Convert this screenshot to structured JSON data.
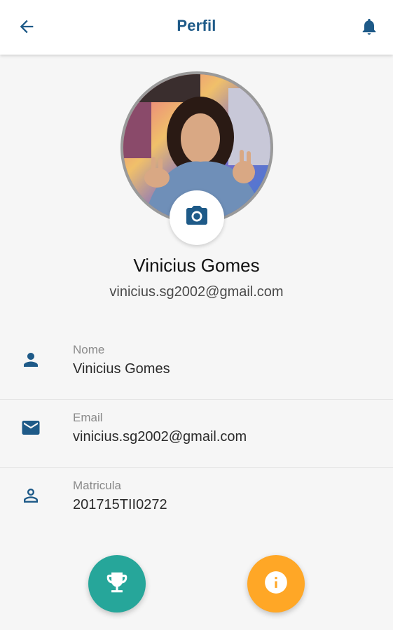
{
  "header": {
    "title": "Perfil",
    "back_icon": "arrow-left-icon",
    "notifications_icon": "bell-icon"
  },
  "profile": {
    "name": "Vinicius Gomes",
    "email": "vinicius.sg2002@gmail.com",
    "photo_icon": "camera-icon"
  },
  "details": [
    {
      "icon": "person-icon",
      "label": "Nome",
      "value": "Vinicius Gomes"
    },
    {
      "icon": "mail-icon",
      "label": "Email",
      "value": "vinicius.sg2002@gmail.com"
    },
    {
      "icon": "person-outline-icon",
      "label": "Matricula",
      "value": "201715TII0272"
    }
  ],
  "actions": [
    {
      "icon": "trophy-icon",
      "color": "#26a69a"
    },
    {
      "icon": "info-icon",
      "color": "#ffa726"
    }
  ],
  "colors": {
    "primary": "#1e5a88",
    "background": "#f6f6f6",
    "trophy_button": "#26a69a",
    "info_button": "#ffa726"
  }
}
